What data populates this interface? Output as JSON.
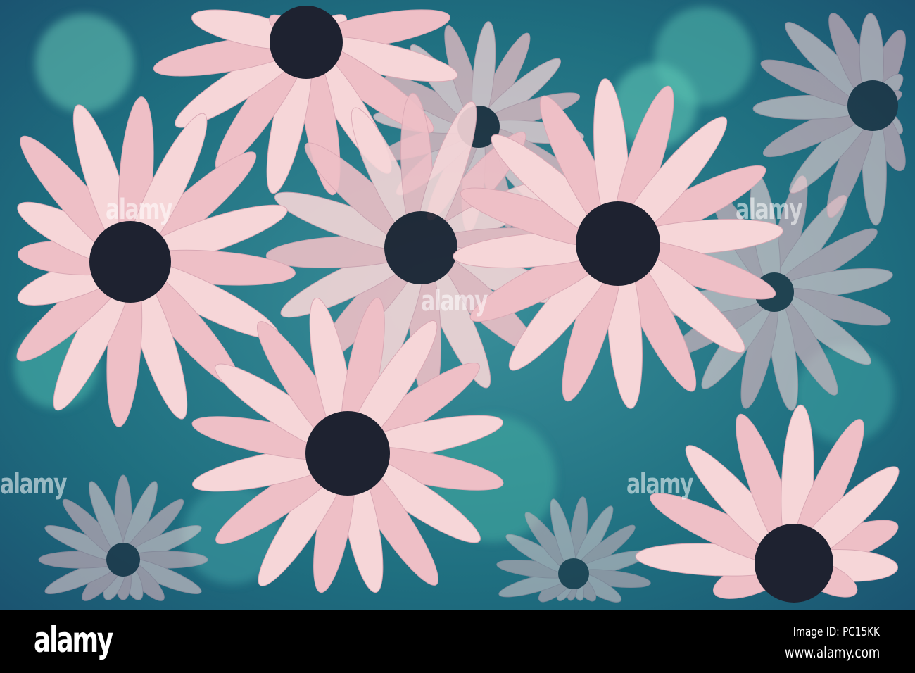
{
  "photo": {
    "subject": "pink-tinted rudbeckia daisies",
    "background_color": "#2a7f8a",
    "petal_color": "#f4cfd2",
    "center_color": "#1e2230"
  },
  "watermark": {
    "text": "alamy"
  },
  "footer": {
    "logo": "alamy",
    "image_id": "Image ID: PC15KK",
    "url": "www.alamy.com"
  }
}
